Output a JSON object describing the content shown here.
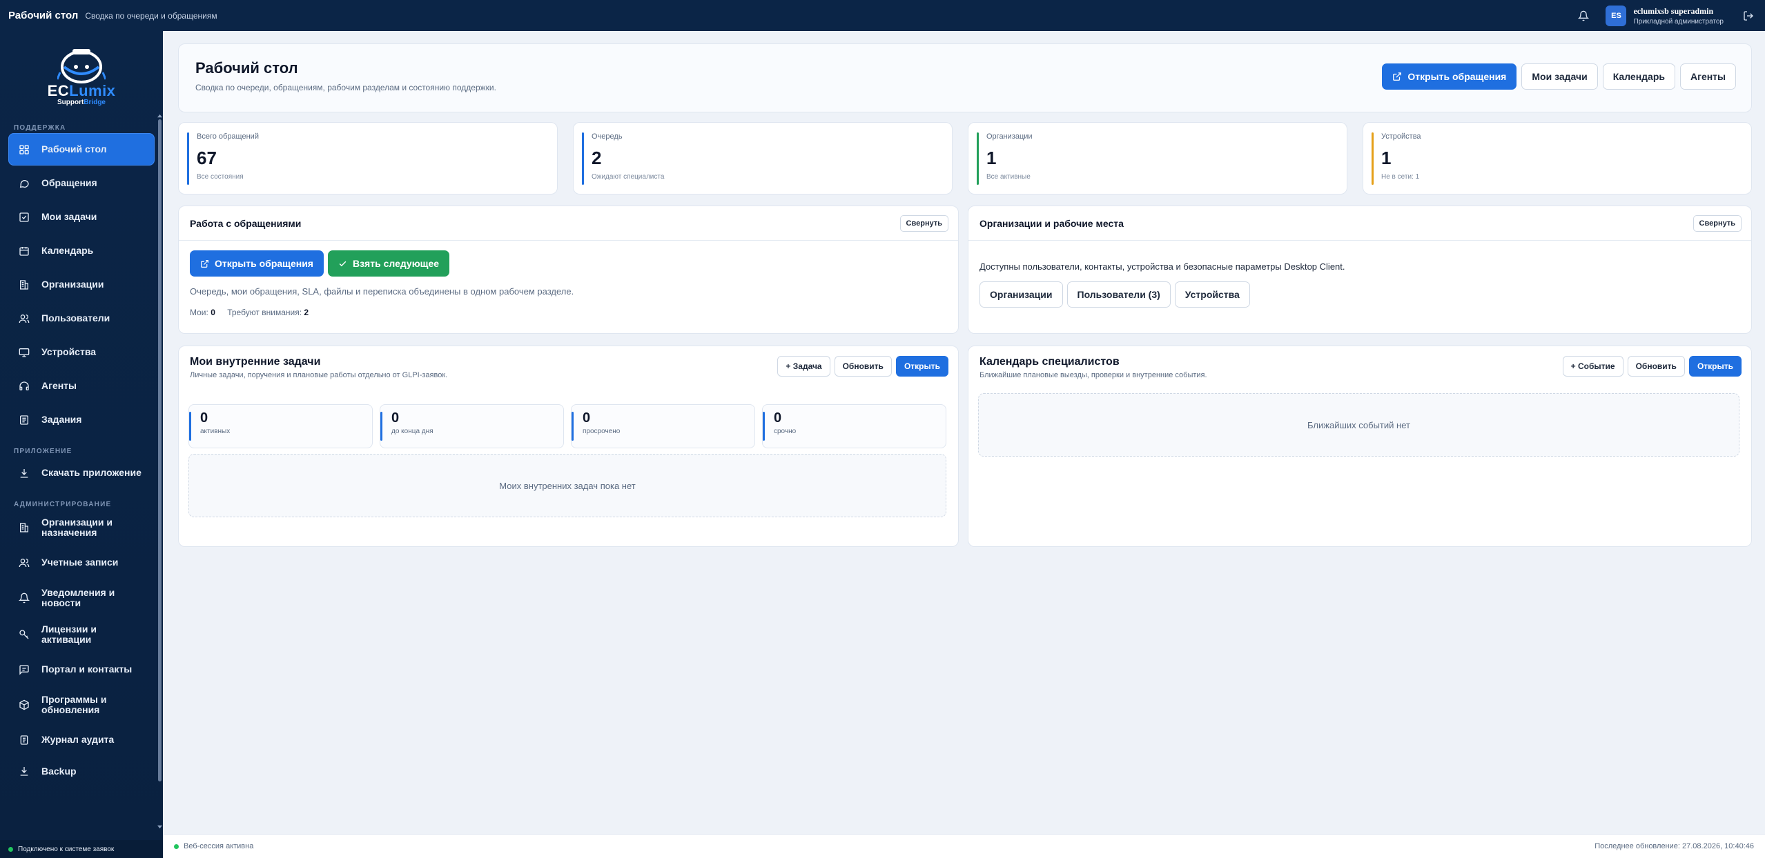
{
  "topbar": {
    "title": "Рабочий стол",
    "subtitle": "Сводка по очереди и обращениям",
    "user_initials": "ES",
    "user_name": "eclumixsb superadmin",
    "user_role": "Прикладной администратор"
  },
  "brand": {
    "name_part1": "EC",
    "name_part2": "Lumix",
    "sub_part1": "Support",
    "sub_part2": "Bridge"
  },
  "sidebar": {
    "sections": {
      "support": "ПОДДЕРЖКА",
      "app": "ПРИЛОЖЕНИЕ",
      "admin": "АДМИНИСТРИРОВАНИЕ"
    },
    "items": [
      {
        "label": "Рабочий стол",
        "icon": "dashboard-icon"
      },
      {
        "label": "Обращения",
        "icon": "chat-icon"
      },
      {
        "label": "Мои задачи",
        "icon": "checkbox-icon"
      },
      {
        "label": "Календарь",
        "icon": "calendar-icon"
      },
      {
        "label": "Организации",
        "icon": "building-icon"
      },
      {
        "label": "Пользователи",
        "icon": "users-icon"
      },
      {
        "label": "Устройства",
        "icon": "monitor-icon"
      },
      {
        "label": "Агенты",
        "icon": "headset-icon"
      },
      {
        "label": "Задания",
        "icon": "list-icon"
      },
      {
        "label": "Скачать приложение",
        "icon": "download-icon"
      },
      {
        "label": "Организации и назначения",
        "icon": "building-icon"
      },
      {
        "label": "Учетные записи",
        "icon": "users-icon"
      },
      {
        "label": "Уведомления и новости",
        "icon": "bell-icon"
      },
      {
        "label": "Лицензии и активации",
        "icon": "key-icon"
      },
      {
        "label": "Портал и контакты",
        "icon": "message-icon"
      },
      {
        "label": "Программы и обновления",
        "icon": "package-icon"
      },
      {
        "label": "Журнал аудита",
        "icon": "journal-icon"
      },
      {
        "label": "Backup",
        "icon": "download-icon"
      }
    ],
    "status": "Подключено к системе заявок"
  },
  "header": {
    "title": "Рабочий стол",
    "subtitle": "Сводка по очереди, обращениям, рабочим разделам и состоянию поддержки.",
    "actions": {
      "open_tickets": "Открыть обращения",
      "my_tasks": "Мои задачи",
      "calendar": "Календарь",
      "agents": "Агенты"
    }
  },
  "stats": [
    {
      "label": "Всего обращений",
      "value": "67",
      "hint": "Все состояния",
      "color": "#1f6fe0"
    },
    {
      "label": "Очередь",
      "value": "2",
      "hint": "Ожидают специалиста",
      "color": "#1f6fe0"
    },
    {
      "label": "Организации",
      "value": "1",
      "hint": "Все активные",
      "color": "#22a05a"
    },
    {
      "label": "Устройства",
      "value": "1",
      "hint": "Не в сети: 1",
      "color": "#e5a019"
    }
  ],
  "tickets_panel": {
    "title": "Работа с обращениями",
    "collapse": "Свернуть",
    "open_btn": "Открыть обращения",
    "take_btn": "Взять следующее",
    "description": "Очередь, мои обращения, SLA, файлы и переписка объединены в одном рабочем разделе.",
    "mine_label": "Мои:",
    "mine_value": "0",
    "attention_label": "Требуют внимания:",
    "attention_value": "2"
  },
  "orgs_panel": {
    "title": "Организации и рабочие места",
    "collapse": "Свернуть",
    "description": "Доступны пользователи, контакты, устройства и безопасные параметры Desktop Client.",
    "btn_orgs": "Организации",
    "btn_users": "Пользователи (3)",
    "btn_devices": "Устройства"
  },
  "tasks_panel": {
    "title": "Мои внутренние задачи",
    "subtitle": "Личные задачи, поручения и плановые работы отдельно от GLPI-заявок.",
    "btn_add": "+ Задача",
    "btn_refresh": "Обновить",
    "btn_open": "Открыть",
    "counters": [
      {
        "value": "0",
        "label": "активных"
      },
      {
        "value": "0",
        "label": "до конца дня"
      },
      {
        "value": "0",
        "label": "просрочено"
      },
      {
        "value": "0",
        "label": "срочно"
      }
    ],
    "empty": "Моих внутренних задач пока нет"
  },
  "calendar_panel": {
    "title": "Календарь специалистов",
    "subtitle": "Ближайшие плановые выезды, проверки и внутренние события.",
    "btn_add": "+ Событие",
    "btn_refresh": "Обновить",
    "btn_open": "Открыть",
    "empty": "Ближайших событий нет"
  },
  "footer": {
    "status": "Веб-сессия активна",
    "updated": "Последнее обновление: 27.08.2026, 10:40:46"
  }
}
